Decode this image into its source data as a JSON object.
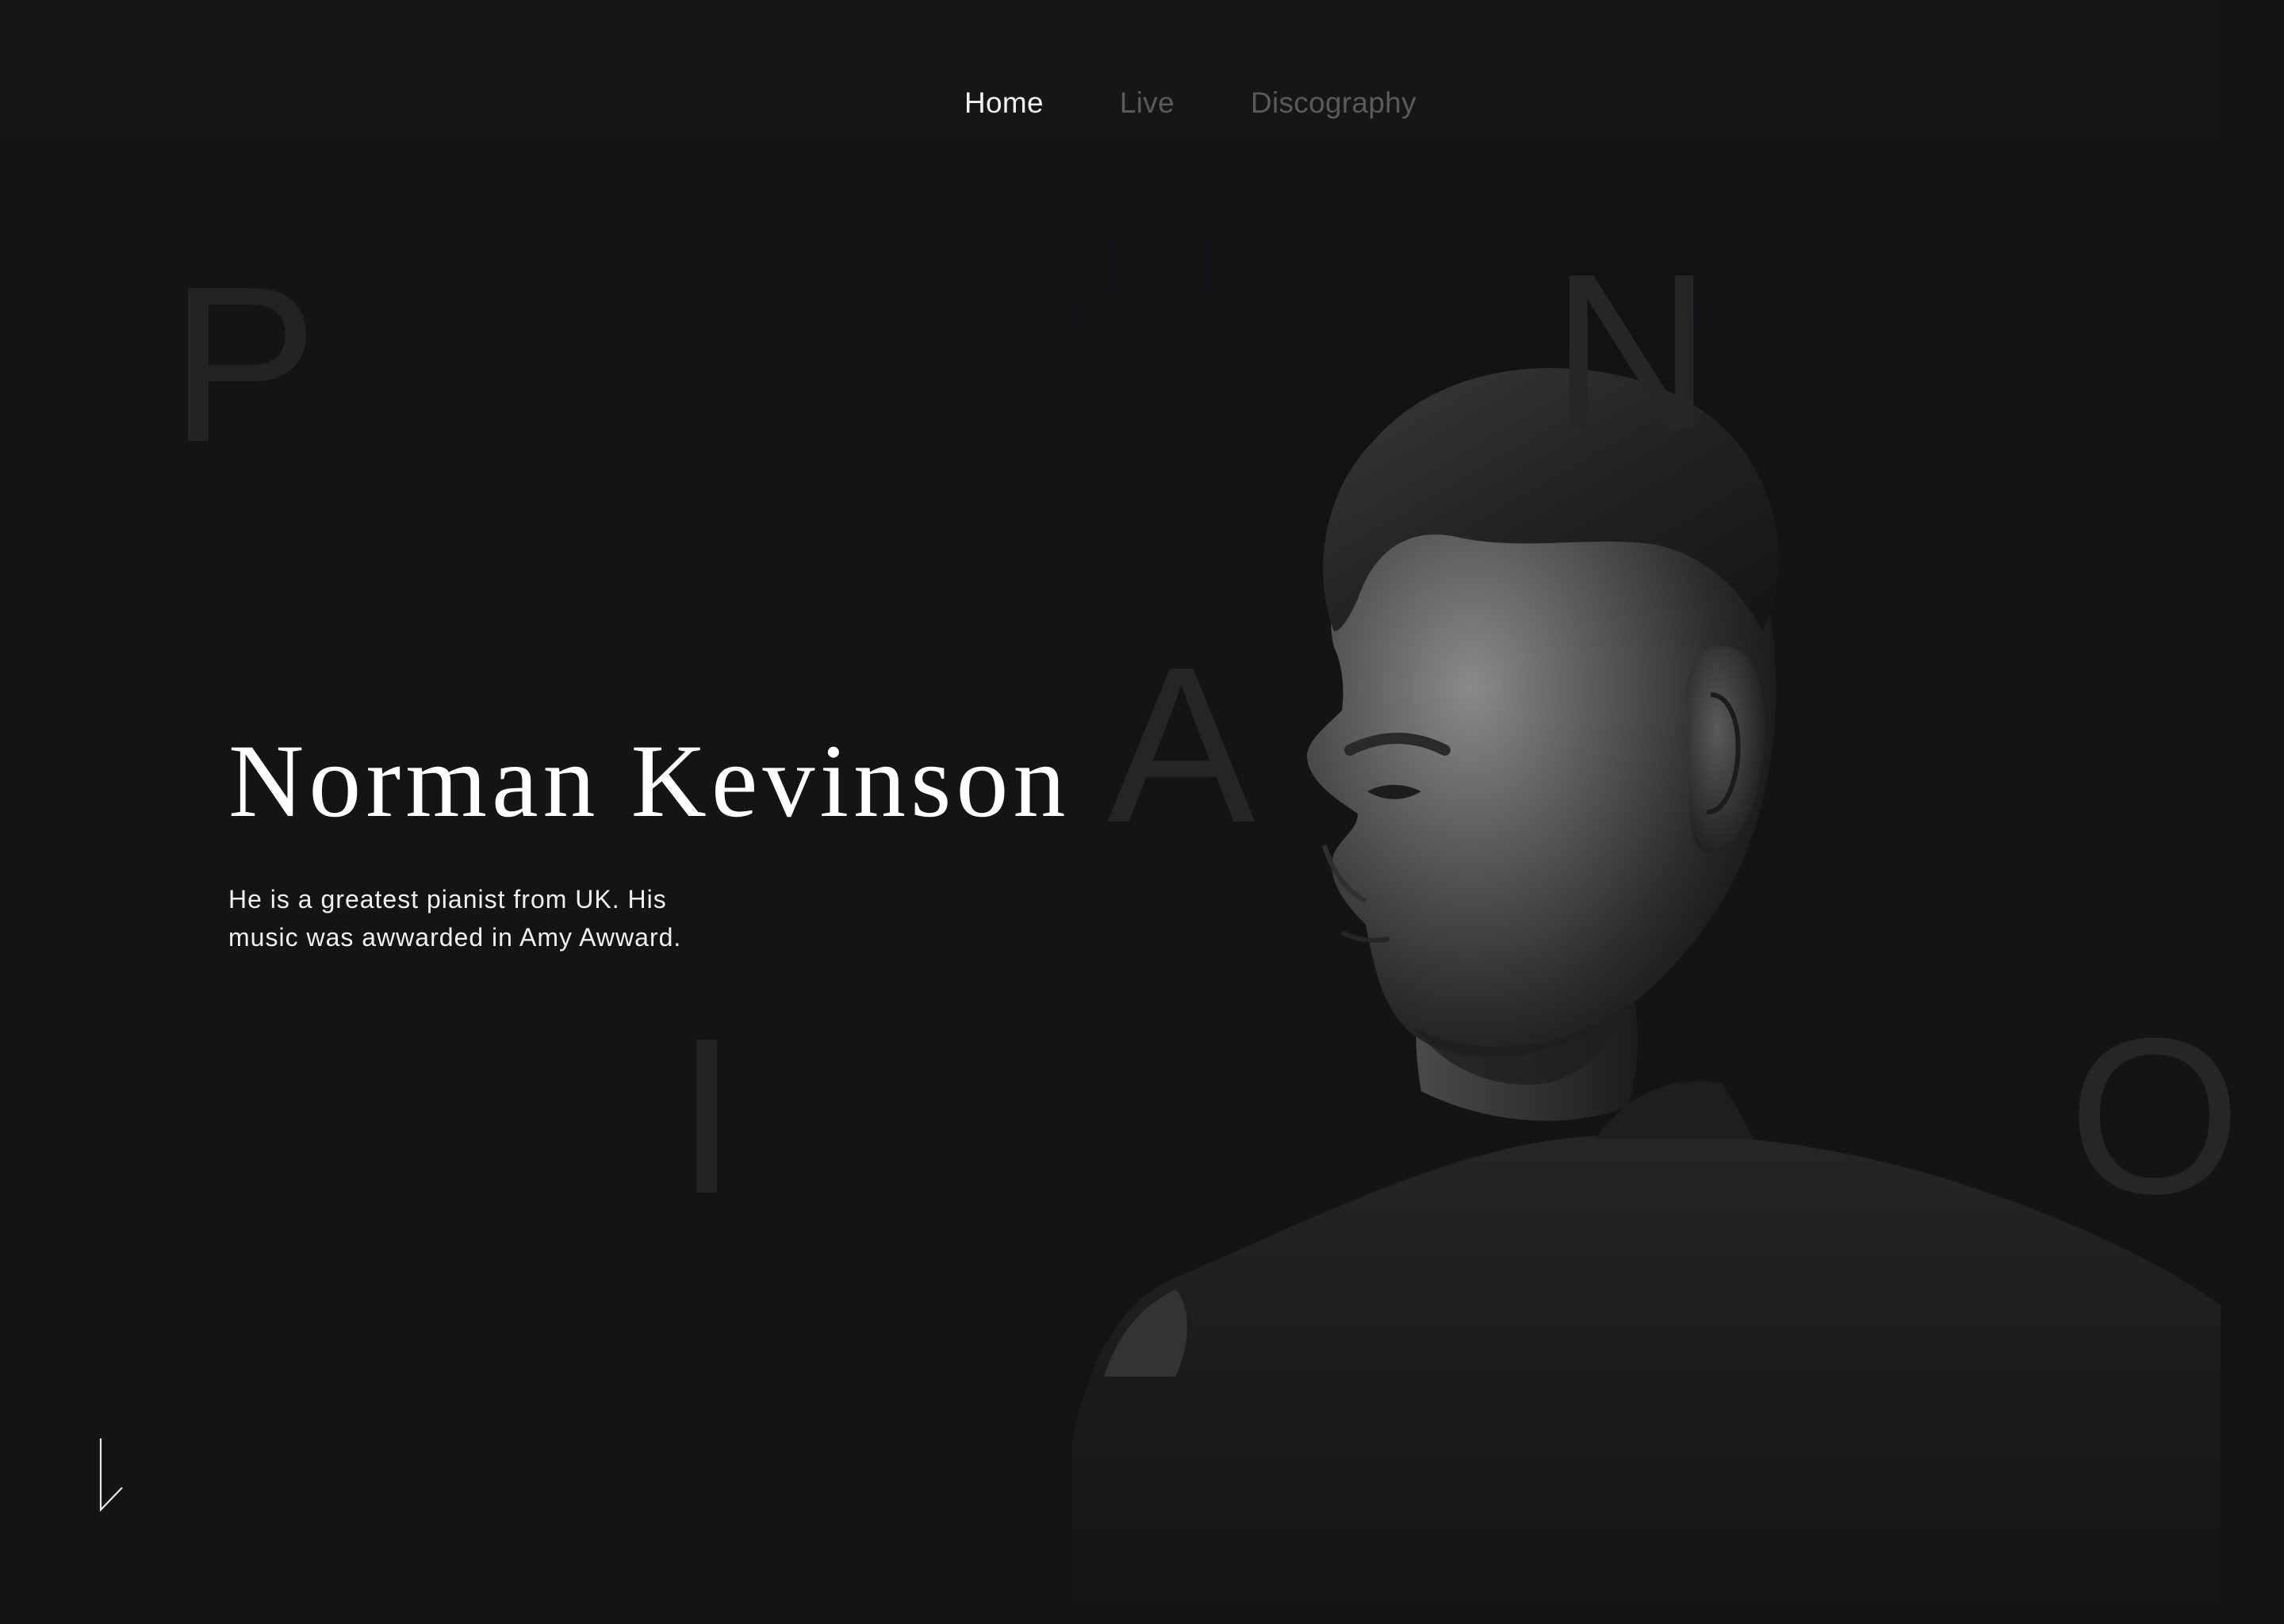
{
  "nav": {
    "items": [
      {
        "label": "Home",
        "active": true
      },
      {
        "label": "Live",
        "active": false
      },
      {
        "label": "Discography",
        "active": false
      }
    ]
  },
  "background_letters": [
    "P",
    "N",
    "A",
    "I",
    "O"
  ],
  "hero": {
    "title": "Norman Kevinson",
    "description": "He is a greatest pianist from UK. His music was awwarded in Amy Awward."
  },
  "icons": {
    "scroll": "down-arrow-icon",
    "portrait": "pianist-portrait"
  },
  "colors": {
    "background": "#141415",
    "text_primary": "#ffffff",
    "nav_inactive": "#5a5a5b",
    "bg_letters": "#232324"
  }
}
